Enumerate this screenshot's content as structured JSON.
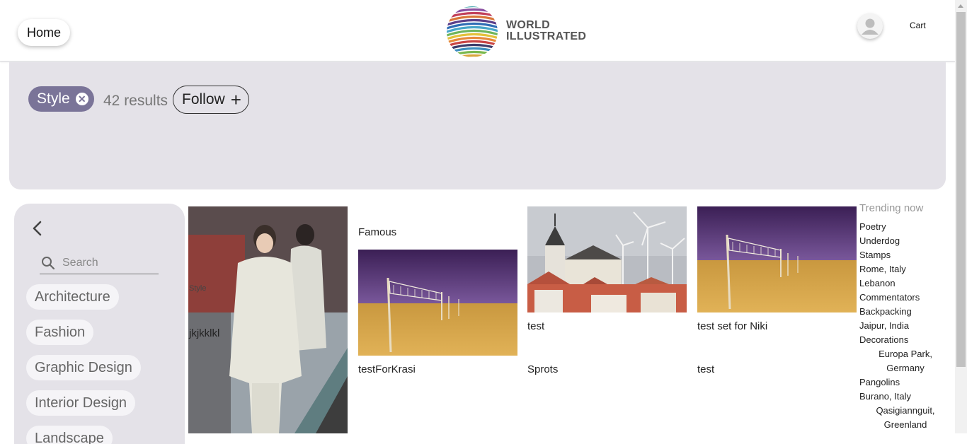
{
  "header": {
    "home_label": "Home",
    "logo_line1": "WORLD",
    "logo_line2": "ILLUSTRATED",
    "cart_label": "Cart"
  },
  "banner": {
    "tag_label": "Style",
    "results_text": "42 results",
    "follow_label": "Follow",
    "follow_icon": "+"
  },
  "sidebar": {
    "search_placeholder": "Search",
    "categories": [
      {
        "label": "Architecture"
      },
      {
        "label": "Fashion"
      },
      {
        "label": "Graphic Design"
      },
      {
        "label": "Interior Design"
      },
      {
        "label": "Landscape"
      }
    ]
  },
  "cards": {
    "fashion_overlay": "jkjkklkl",
    "fashion_overlay_small": "Style",
    "col2_heading": "Famous",
    "col2_caption": "testForKrasi",
    "col3_title": "test",
    "col3_caption": "Sprots",
    "col4_title": "test set for Niki",
    "col4_caption": "test"
  },
  "trending": {
    "title": "Trending now",
    "items": [
      "Poetry",
      "Underdog",
      "Stamps",
      "Rome, Italy",
      "Lebanon",
      "Commentators",
      "Backpacking",
      "Jaipur, India",
      "Decorations",
      "Europa Park, Germany",
      "Pangolins",
      "Burano, Italy",
      "Qasigiannguit, Greenland"
    ]
  },
  "colors": {
    "accent": "#7a7498",
    "banner_bg": "#e4e2e8",
    "chip_bg": "#f5f4f7"
  }
}
